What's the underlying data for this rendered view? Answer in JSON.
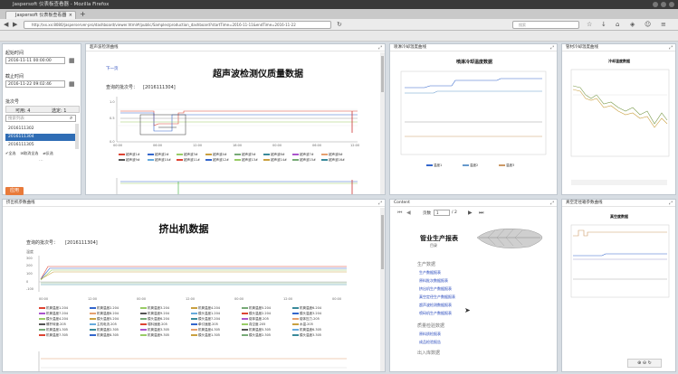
{
  "window": {
    "title": "Jaspersoft 仪表板查看器 - Mozilla Firefox"
  },
  "tab": {
    "label": "Jaspersoft 仪表板查看器",
    "close": "×",
    "new": "+"
  },
  "url": "http://xx.xx:8080/jasperserver-pro/dashboard/viewer.html#/public/Samples/production_dashboard?startTime=2016-11-11&endTime=2016-11-22",
  "search_placeholder": "搜索",
  "filters": {
    "start_label": "起始时间",
    "start_value": "2016-11-11 00:00:00",
    "end_label": "截止时间",
    "end_value": "2016-11-22 09:02:46",
    "batch_label": "批次号",
    "tab_available": "可用: 4",
    "tab_selected": "选定: 1",
    "search_placeholder": "搜索列表",
    "items": [
      "2016111302",
      "2016111304",
      "2016111305"
    ],
    "all": "全选",
    "none": "取消全选",
    "invert": "反选",
    "apply": "应用"
  },
  "ultrasonic_panel": {
    "title": "超声波检测曲线",
    "link": "下一页",
    "report_title": "超声波检测仪质量数据",
    "query_label": "查询的批次号：",
    "query_value": "[2016111304]",
    "y_ticks": [
      "1.0",
      "0.5",
      "0.0"
    ],
    "x_ticks": [
      "00:00",
      "06:00",
      "12:00",
      "18:00",
      "00:00",
      "06:00",
      "12:00"
    ],
    "legend": [
      "超声波1#",
      "超声波2#",
      "超声波3#",
      "超声波4#",
      "超声波5#",
      "超声波6#",
      "超声波7#",
      "超声波8#",
      "超声波9#",
      "超声波10#",
      "超声波11#",
      "超声波12#",
      "超声波13#",
      "超声波14#",
      "超声波15#",
      "超声波16#"
    ]
  },
  "spray_panel": {
    "title": "喷淋冷却温度曲线",
    "chart_title": "喷淋冷却温度数据",
    "legend": [
      "温度1",
      "温度2",
      "温度3"
    ]
  },
  "cooling_panel": {
    "title": "管材冷却温度曲线",
    "chart_title": "冷却温度数据"
  },
  "extruder_panel": {
    "title": "挤出机参数曲线",
    "report_title": "挤出机数据",
    "query_label": "查询的批次号：",
    "query_value": "[2016111304]",
    "y_label": "温度",
    "y_ticks": [
      "300",
      "200",
      "100",
      "0",
      "-100"
    ],
    "x_ticks": [
      "00:00",
      "12:00",
      "00:00",
      "12:00",
      "00:00",
      "12:00",
      "00:00"
    ],
    "legend": [
      "机筒温度1.204",
      "机筒温度2.204",
      "机筒温度3.204",
      "机筒温度4.204",
      "机筒温度5.204",
      "机筒温度6.204",
      "机筒温度7.204",
      "机筒温度8.204",
      "机筒温度9.204",
      "模头温度1.204",
      "模头温度2.204",
      "模头温度3.204",
      "模头温度4.204",
      "模头温度5.204",
      "模头温度6.204",
      "模头温度7.204",
      "熔体温度.205",
      "熔体压力.205",
      "螺杆转速.205",
      "主机电流.205",
      "喂料速度.205",
      "牵引速度.205",
      "真空度.205",
      "水温.205",
      "机筒温度1.305",
      "机筒温度2.305",
      "机筒温度3.305",
      "机筒温度4.305",
      "机筒温度5.305",
      "机筒温度6.305",
      "机筒温度7.305",
      "机筒温度8.305",
      "机筒温度9.305",
      "模头温度1.305",
      "模头温度2.305",
      "模头温度3.305"
    ]
  },
  "content_panel": {
    "title": "Content",
    "page_label": "页数",
    "page_value": "1",
    "page_total": "/ 2",
    "report_title": "管业生产报表",
    "subtitle": "目录",
    "sections": [
      {
        "heading": "生产数据",
        "links": [
          "生产数据报表",
          "原料批次数据报表",
          "挤出机生产数据报表",
          "真空定径生产数据报表",
          "超声波检测数据报表",
          "喷码机生产数据报表"
        ]
      },
      {
        "heading": "质量检验数据",
        "links": [
          "原料质检报表",
          "成品检验报告"
        ]
      },
      {
        "heading": "出入库数据",
        "links": []
      }
    ]
  },
  "vacuum_panel": {
    "title": "真空定径箱参数曲线",
    "chart_title": "真空度数据"
  },
  "colors": {
    "accent": "#e87a3a",
    "selected": "#2f6db5",
    "link": "#2244bb"
  }
}
